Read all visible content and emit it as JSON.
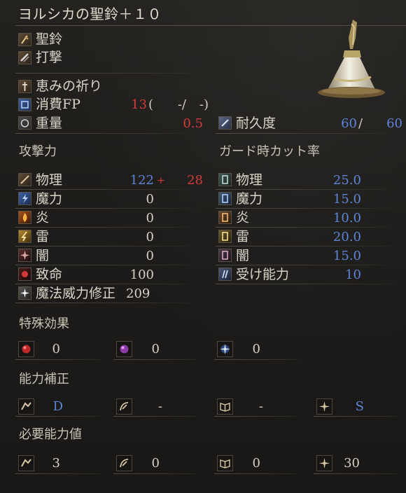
{
  "title": "ヨルシカの聖鈴＋１０",
  "item_lines": {
    "category": "聖鈴",
    "attack_type": "打撃",
    "skill": "恵みの祈り"
  },
  "fp": {
    "label": "消費FP",
    "value": "13",
    "open": "(",
    "mid": "-/",
    "close": "-)"
  },
  "weight": {
    "label": "重量",
    "value": "0.5"
  },
  "durability": {
    "label": "耐久度",
    "current": "60",
    "slash": "/",
    "max": "60"
  },
  "attack": {
    "header": "攻撃力",
    "rows": [
      {
        "label": "物理",
        "value": "122",
        "plus": "+",
        "bonus": "28"
      },
      {
        "label": "魔力",
        "value": "0"
      },
      {
        "label": "炎",
        "value": "0"
      },
      {
        "label": "雷",
        "value": "0"
      },
      {
        "label": "闇",
        "value": "0"
      },
      {
        "label": "致命",
        "value": "100"
      },
      {
        "label": "魔法威力修正",
        "value": "209"
      }
    ]
  },
  "guard": {
    "header": "ガード時カット率",
    "rows": [
      {
        "label": "物理",
        "value": "25.0"
      },
      {
        "label": "魔力",
        "value": "15.0"
      },
      {
        "label": "炎",
        "value": "10.0"
      },
      {
        "label": "雷",
        "value": "20.0"
      },
      {
        "label": "闇",
        "value": "15.0"
      },
      {
        "label": "受け能力",
        "value": "10"
      }
    ]
  },
  "special": {
    "header": "特殊効果",
    "values": [
      "0",
      "0",
      "0"
    ]
  },
  "scaling": {
    "header": "能力補正",
    "values": [
      "D",
      "-",
      "-",
      "S"
    ]
  },
  "requirements": {
    "header": "必要能力値",
    "values": [
      "3",
      "0",
      "0",
      "30"
    ]
  },
  "colors": {
    "blue": "#5d86d8",
    "red": "#d43b3b"
  }
}
